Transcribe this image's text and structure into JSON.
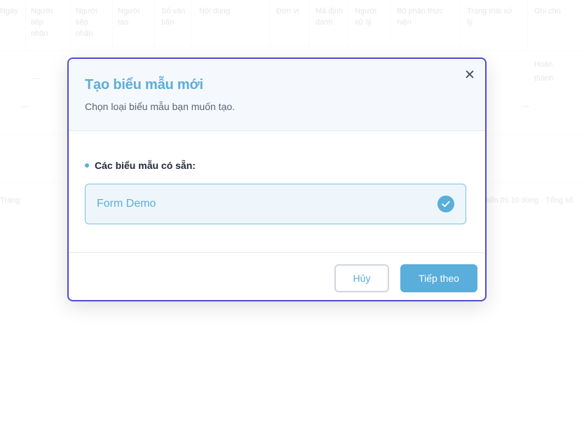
{
  "background": {
    "columns": [
      "Ngày",
      "Người tiếp nhận",
      "Người tiếp nhận",
      "Người tạo",
      "Số văn bản",
      "Nội dung",
      "Đơn vị",
      "Mã định danh",
      "Người xử lý",
      "Bộ phận thực hiện",
      "Trạng thái xử lý",
      "Ghi chú"
    ],
    "row_cells": [
      "—",
      "—",
      "—",
      "Hoàn thành"
    ],
    "footer_left": "Trang",
    "footer_right": [
      "Hiển thị 10 dòng",
      "Tổng số"
    ]
  },
  "dialog": {
    "title": "Tạo biểu mẫu mới",
    "subtitle": "Chọn loại biểu mẫu bạn muốn tạo.",
    "close_icon": "close-icon",
    "section_label": "Các biểu mẫu có sẵn:",
    "options": [
      {
        "label": "Form Demo",
        "selected": true,
        "icon": "check-circle-icon"
      }
    ],
    "cancel_label": "Hủy",
    "next_label": "Tiếp theo"
  },
  "colors": {
    "accent": "#5aaedb",
    "dialog_border": "#4f4cd6",
    "header_bg": "#f5f9fd",
    "option_bg": "#eef6fb"
  }
}
